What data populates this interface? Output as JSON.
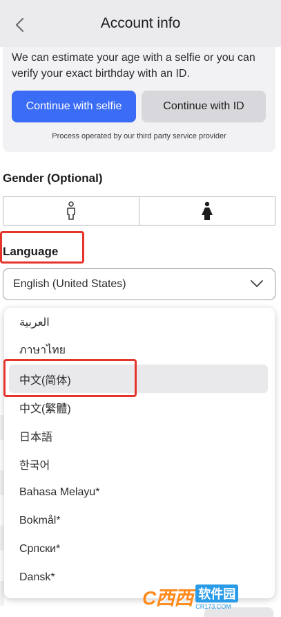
{
  "header": {
    "title": "Account info",
    "back_icon": "chevron-left-icon"
  },
  "age_card": {
    "description": "We can estimate your age with a selfie or you can verify your exact birthday with an ID.",
    "selfie_button": "Continue with selfie",
    "id_button": "Continue with ID",
    "provider_note": "Process operated by our third party service provider",
    "primary_color": "#3b6cf5"
  },
  "gender": {
    "label": "Gender (Optional)",
    "options": [
      {
        "icon": "male-icon"
      },
      {
        "icon": "female-icon"
      }
    ]
  },
  "language": {
    "label": "Language",
    "selected_value": "English (United States)",
    "options": [
      "العربية",
      "ภาษาไทย",
      "中文(简体)",
      "中文(繁體)",
      "日本語",
      "한국어",
      "Bahasa Melayu*",
      "Bokmål*",
      "Српски*",
      "Dansk*"
    ],
    "highlighted_option_index": 2
  },
  "watermark": {
    "logo": "C西西",
    "main": "软件园",
    "sub": "CR173.COM"
  },
  "annotation_color": "#e5352b"
}
